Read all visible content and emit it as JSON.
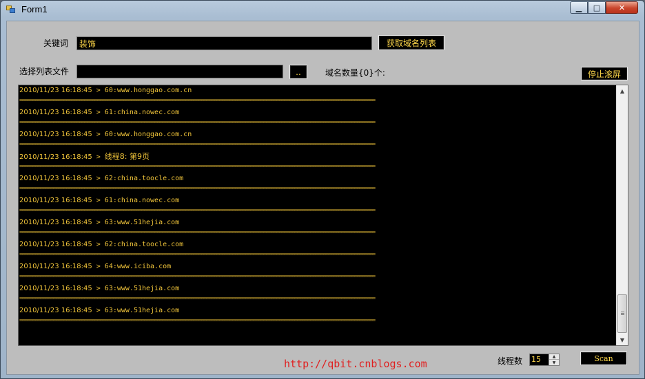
{
  "window": {
    "title": "Form1",
    "controls": {
      "minimize": "▁",
      "maximize": "□",
      "close": "✕"
    }
  },
  "form": {
    "keyword_label": "关键词",
    "keyword_value": "装饰",
    "get_domains_button": "获取域名列表",
    "list_file_label": "选择列表文件",
    "list_file_value": "",
    "browse_button": "..",
    "domain_count_label": "域名数量{0}个:",
    "stop_scroll_button": "停止滚屏"
  },
  "log": {
    "separator": "=========================================================================================================================================",
    "entries": [
      {
        "time": "2010/11/23 16:18:45",
        "message": "60:www.honggao.com.cn"
      },
      {
        "time": "2010/11/23 16:18:45",
        "message": "61:china.nowec.com"
      },
      {
        "time": "2010/11/23 16:18:45",
        "message": "60:www.honggao.com.cn"
      },
      {
        "time": "2010/11/23 16:18:45",
        "message": "线程8:  第9页"
      },
      {
        "time": "2010/11/23 16:18:45",
        "message": "62:china.toocle.com"
      },
      {
        "time": "2010/11/23 16:18:45",
        "message": "61:china.nowec.com"
      },
      {
        "time": "2010/11/23 16:18:45",
        "message": "63:www.51hejia.com"
      },
      {
        "time": "2010/11/23 16:18:45",
        "message": "62:china.toocle.com"
      },
      {
        "time": "2010/11/23 16:18:45",
        "message": "64:www.iciba.com"
      },
      {
        "time": "2010/11/23 16:18:45",
        "message": "63:www.51hejia.com"
      },
      {
        "time": "2010/11/23 16:18:45",
        "message": "63:www.51hejia.com"
      }
    ]
  },
  "footer": {
    "thread_count_label": "线程数",
    "thread_count_value": "15",
    "scan_button": "Scan",
    "watermark": "http://qbit.cnblogs.com"
  },
  "colors": {
    "text_yellow": "#ffd84a",
    "log_background": "#000000",
    "form_background": "#bdbdbd",
    "watermark_red": "#e02020"
  }
}
